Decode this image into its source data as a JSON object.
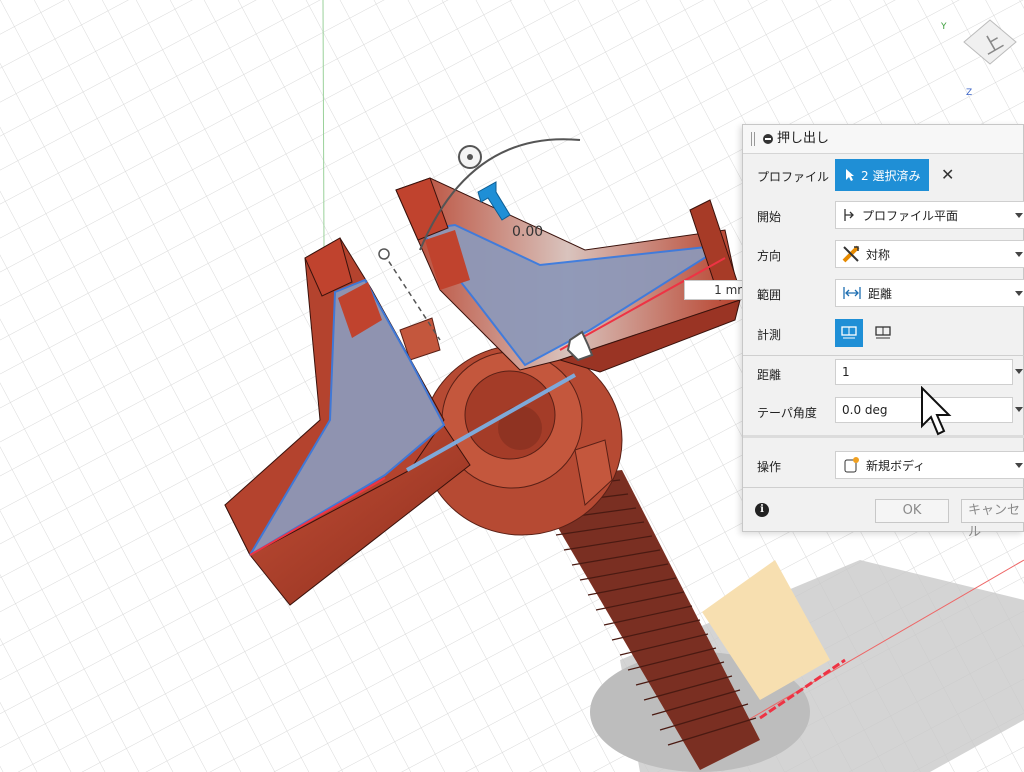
{
  "viewport": {
    "dimension_value": "1 mm",
    "angle_value": "0.00"
  },
  "viewcube": {
    "face_label": "上",
    "axis_y": "Y",
    "axis_z": "Z"
  },
  "dialog": {
    "title": "押し出し",
    "profile": {
      "label": "プロファイル",
      "selection": "2 選択済み",
      "clear": "✕"
    },
    "start": {
      "label": "開始",
      "value": "プロファイル平面"
    },
    "direction": {
      "label": "方向",
      "value": "対称"
    },
    "extent": {
      "label": "範囲",
      "value": "距離"
    },
    "measure": {
      "label": "計測"
    },
    "distance": {
      "label": "距離",
      "value": "1"
    },
    "taper": {
      "label": "テーパ角度",
      "value": "0.0 deg"
    },
    "operation": {
      "label": "操作",
      "value": "新規ボディ"
    },
    "ok": "OK",
    "cancel": "キャンセル"
  },
  "colors": {
    "accent": "#1f8fd6",
    "body": "#b8452f",
    "profile_fill": "#8f9ab8",
    "profile_edge": "#3a7be0",
    "grid": "#d6d6d6"
  }
}
